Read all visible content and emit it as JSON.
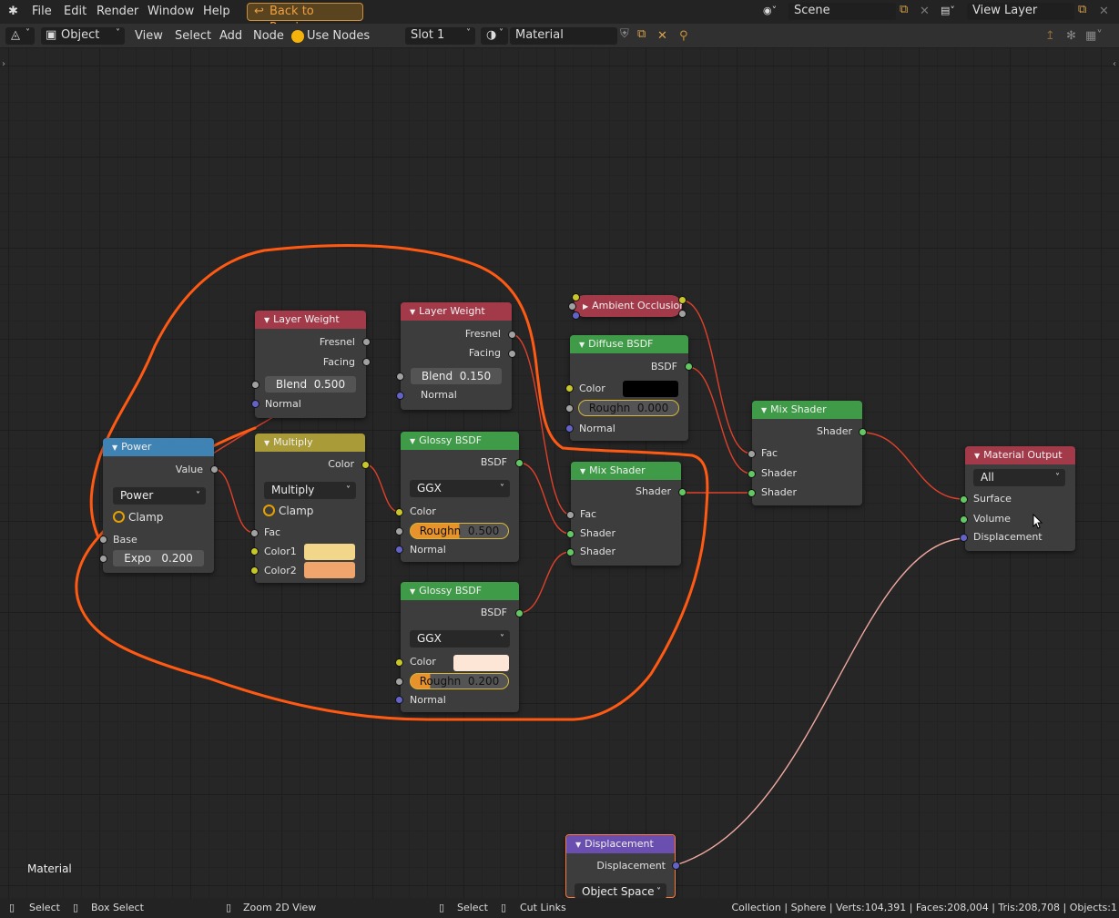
{
  "topbar": {
    "menu": [
      "File",
      "Edit",
      "Render",
      "Window",
      "Help"
    ],
    "back_label": "Back to Previous",
    "scene": "Scene",
    "view_layer": "View Layer"
  },
  "header": {
    "mode": "Object",
    "menus": [
      "View",
      "Select",
      "Add",
      "Node"
    ],
    "use_nodes": "Use Nodes",
    "slot": "Slot 1",
    "material": "Material"
  },
  "canvas_label": "Material",
  "nodes": {
    "power": {
      "title": "Power",
      "value": "Value",
      "op": "Power",
      "clamp": "Clamp",
      "base": "Base",
      "expo": "Expo",
      "expo_val": "0.200"
    },
    "lw1": {
      "title": "Layer Weight",
      "fresnel": "Fresnel",
      "facing": "Facing",
      "blend": "Blend",
      "blend_val": "0.500",
      "normal": "Normal"
    },
    "lw2": {
      "title": "Layer Weight",
      "fresnel": "Fresnel",
      "facing": "Facing",
      "blend": "Blend",
      "blend_val": "0.150",
      "normal": "Normal"
    },
    "multiply": {
      "title": "Multiply",
      "color": "Color",
      "op": "Multiply",
      "clamp": "Clamp",
      "fac": "Fac",
      "color1": "Color1",
      "color2": "Color2",
      "color1_hex": "#f2d68a",
      "color2_hex": "#f0a56c"
    },
    "glossy1": {
      "title": "Glossy BSDF",
      "bsdf": "BSDF",
      "dist": "GGX",
      "color": "Color",
      "rough": "Roughn",
      "rough_val": "0.500",
      "normal": "Normal"
    },
    "glossy2": {
      "title": "Glossy BSDF",
      "bsdf": "BSDF",
      "dist": "GGX",
      "color": "Color",
      "color_hex": "#fde6d6",
      "rough": "Roughn",
      "rough_val": "0.200",
      "normal": "Normal"
    },
    "ao": {
      "title": "Ambient Occlusion"
    },
    "diffuse": {
      "title": "Diffuse BSDF",
      "bsdf": "BSDF",
      "color": "Color",
      "color_hex": "#000000",
      "rough": "Roughn",
      "rough_val": "0.000",
      "normal": "Normal"
    },
    "mix1": {
      "title": "Mix Shader",
      "shader_out": "Shader",
      "fac": "Fac",
      "shader_a": "Shader",
      "shader_b": "Shader"
    },
    "mix2": {
      "title": "Mix Shader",
      "shader_out": "Shader",
      "fac": "Fac",
      "shader_a": "Shader",
      "shader_b": "Shader"
    },
    "output": {
      "title": "Material Output",
      "target": "All",
      "surface": "Surface",
      "volume": "Volume",
      "displacement": "Displacement"
    },
    "disp": {
      "title": "Displacement",
      "out": "Displacement",
      "space": "Object Space"
    }
  },
  "colors": {
    "header_input": "#a33a4a",
    "header_converter": "#3f82b4",
    "header_color": "#a89b38",
    "header_shader": "#3f9b48",
    "header_output": "#a33a4a",
    "header_vector": "#6a4fb0",
    "wire": "#e0402a",
    "annotation": "#ff5a14"
  },
  "statusbar": {
    "select": "Select",
    "box_select": "Box Select",
    "zoom": "Zoom 2D View",
    "select2": "Select",
    "cut_links": "Cut Links",
    "stats": "Collection | Sphere | Verts:104,391 | Faces:208,004 | Tris:208,708 | Objects:1"
  }
}
